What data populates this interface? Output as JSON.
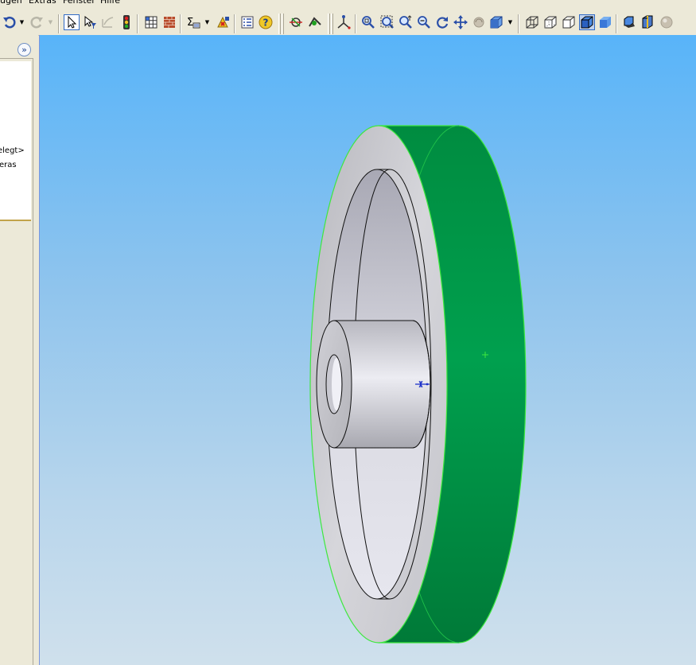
{
  "menu": {
    "items": [
      "ugen",
      "Extras",
      "Fenster",
      "Hilfe"
    ]
  },
  "toolbar": {
    "icons": [
      "undo-icon",
      "redo-icon",
      "select-icon",
      "selection-filter-icon",
      "sketch-icon",
      "traffic-light-icon",
      "grid-icon",
      "brick-icon",
      "sum-icon",
      "rebuild-icon",
      "properties-icon",
      "help-icon",
      "measure-icon",
      "mass-properties-icon",
      "orientation-icon",
      "zoom-fit-icon",
      "zoom-area-icon",
      "zoom-in-out-icon",
      "zoom-selection-icon",
      "rotate-icon",
      "pan-icon",
      "view-orient-icon",
      "display-style-icon",
      "wireframe-icon",
      "hidden-lines-visible-icon",
      "hidden-lines-removed-icon",
      "shaded-edges-icon",
      "shaded-icon",
      "shadows-icon",
      "section-view-icon",
      "realview-icon"
    ]
  },
  "feature_tree": {
    "expand_label": "»",
    "lines": [
      "elegt>",
      "eras"
    ]
  },
  "colors": {
    "viewport_top": "#58b4f9",
    "viewport_bottom": "#cfe0ec",
    "wheel_rim": "#009b48",
    "wheel_face": "#cfcfd4",
    "edge_highlight": "#33e633"
  }
}
